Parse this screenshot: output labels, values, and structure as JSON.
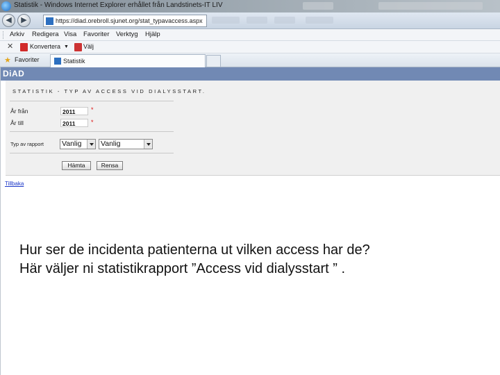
{
  "window": {
    "title": "Statistik - Windows Internet Explorer erhållet från Landstinets-IT LIV"
  },
  "address_bar": {
    "url": "https://diad.orebroll.sjunet.org/stat_typavaccess.aspx"
  },
  "menu": [
    "Arkiv",
    "Redigera",
    "Visa",
    "Favoriter",
    "Verktyg",
    "Hjälp"
  ],
  "command_bar": {
    "convert_label": "Konvertera",
    "select_label": "Välj"
  },
  "favorites_bar": {
    "favorites_label": "Favoriter",
    "tab_label": "Statistik"
  },
  "app": {
    "logo": "DiAD"
  },
  "form": {
    "heading": "STATISTIK - TYP AV ACCESS VID DIALYSSTART.",
    "from_year_label": "År från",
    "from_year_value": "2011",
    "to_year_label": "År till",
    "to_year_value": "2011",
    "required_mark": "*",
    "report_type_label": "Typ av rapport",
    "report_select_1": "Vanlig",
    "report_select_2": "Vanlig",
    "fetch_button": "Hämta",
    "clear_button": "Rensa"
  },
  "back_link": "Tillbaka",
  "caption": {
    "line1": "Hur ser de incidenta patienterna ut vilken access har de?",
    "line2": "Här väljer ni statistikrapport ”Access vid dialysstart ” ."
  },
  "colors": {
    "app_header": "#7189b4",
    "panel_bg": "#f0f0f0",
    "required": "#dd1111",
    "link": "#1a36c8"
  }
}
